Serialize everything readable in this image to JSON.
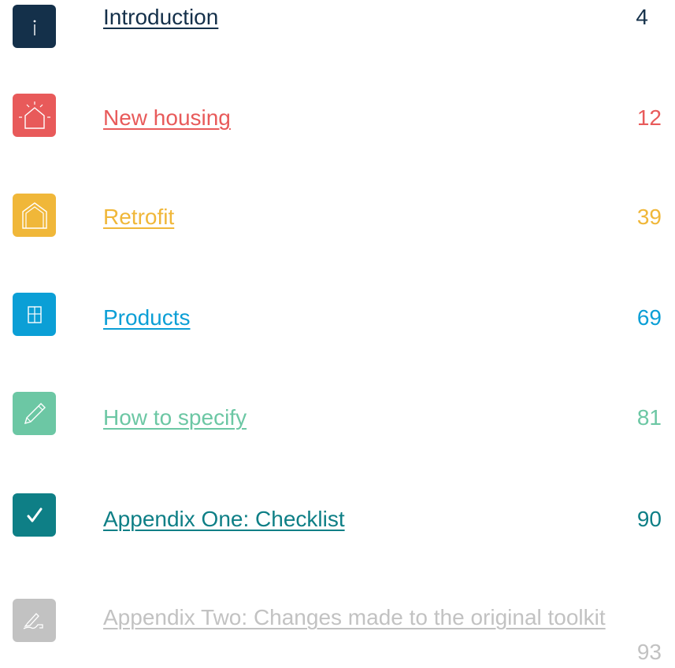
{
  "toc": {
    "entries": [
      {
        "label": "Introduction",
        "page": "4",
        "icon": "info-icon",
        "color": "#14304a"
      },
      {
        "label": "New housing",
        "page": "12",
        "icon": "new-house-icon",
        "color": "#e85a5a"
      },
      {
        "label": "Retrofit",
        "page": "39",
        "icon": "house-outline-icon",
        "color": "#f0b739"
      },
      {
        "label": "Products",
        "page": "69",
        "icon": "window-icon",
        "color": "#0b9fd6"
      },
      {
        "label": "How to specify",
        "page": "81",
        "icon": "pencil-icon",
        "color": "#6cc7a4"
      },
      {
        "label": "Appendix One: Checklist",
        "page": "90",
        "icon": "checkmark-icon",
        "color": "#0e7f86"
      },
      {
        "label": "Appendix Two: Changes made to the original toolkit",
        "page": "93",
        "icon": "signature-icon",
        "color": "#c2c2c2"
      }
    ]
  }
}
